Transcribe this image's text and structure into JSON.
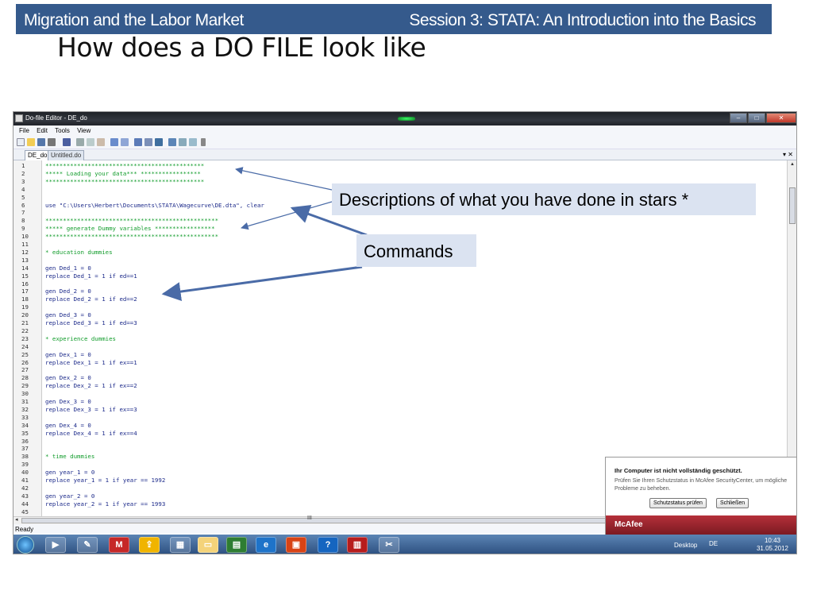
{
  "slide": {
    "course": "Migration and the Labor Market",
    "session": "Session 3: STATA: An Introduction into the Basics",
    "title": "How does a DO FILE look like"
  },
  "window": {
    "title": "Do-file Editor - DE_do",
    "menu": [
      "File",
      "Edit",
      "Tools",
      "View"
    ],
    "tabs": [
      {
        "label": "DE_do",
        "active": true
      },
      {
        "label": "Untitled.do",
        "active": false
      }
    ],
    "status": "Ready",
    "scroll_marker": "III"
  },
  "code_lines": [
    {
      "n": "1",
      "text": "*********************************************",
      "color": "green"
    },
    {
      "n": "2",
      "text": "***** Loading your data*** *****************",
      "color": "green"
    },
    {
      "n": "3",
      "text": "*********************************************",
      "color": "green"
    },
    {
      "n": "4",
      "text": "",
      "color": "navy"
    },
    {
      "n": "5",
      "text": "",
      "color": "navy"
    },
    {
      "n": "6",
      "text": "use \"C:\\Users\\Herbert\\Documents\\STATA\\Wagecurve\\DE.dta\", clear",
      "color": "navy"
    },
    {
      "n": "7",
      "text": "",
      "color": "navy"
    },
    {
      "n": "8",
      "text": "*************************************************",
      "color": "green"
    },
    {
      "n": "9",
      "text": "***** generate Dummy variables *****************",
      "color": "green"
    },
    {
      "n": "10",
      "text": "*************************************************",
      "color": "green"
    },
    {
      "n": "11",
      "text": "",
      "color": "navy"
    },
    {
      "n": "12",
      "text": "* education dummies",
      "color": "green"
    },
    {
      "n": "13",
      "text": "",
      "color": "navy"
    },
    {
      "n": "14",
      "text": "gen Ded_1 = 0",
      "color": "navy"
    },
    {
      "n": "15",
      "text": "replace Ded_1 = 1 if ed==1",
      "color": "navy"
    },
    {
      "n": "16",
      "text": "",
      "color": "navy"
    },
    {
      "n": "17",
      "text": "gen Ded_2 = 0",
      "color": "navy"
    },
    {
      "n": "18",
      "text": "replace Ded_2 = 1 if ed==2",
      "color": "navy"
    },
    {
      "n": "19",
      "text": "",
      "color": "navy"
    },
    {
      "n": "20",
      "text": "gen Ded_3 = 0",
      "color": "navy"
    },
    {
      "n": "21",
      "text": "replace Ded_3 = 1 if ed==3",
      "color": "navy"
    },
    {
      "n": "22",
      "text": "",
      "color": "navy"
    },
    {
      "n": "23",
      "text": "* experience dummies",
      "color": "green"
    },
    {
      "n": "24",
      "text": "",
      "color": "navy"
    },
    {
      "n": "25",
      "text": "gen Dex_1 = 0",
      "color": "navy"
    },
    {
      "n": "26",
      "text": "replace Dex_1 = 1 if ex==1",
      "color": "navy"
    },
    {
      "n": "27",
      "text": "",
      "color": "navy"
    },
    {
      "n": "28",
      "text": "gen Dex_2 = 0",
      "color": "navy"
    },
    {
      "n": "29",
      "text": "replace Dex_2 = 1 if ex==2",
      "color": "navy"
    },
    {
      "n": "30",
      "text": "",
      "color": "navy"
    },
    {
      "n": "31",
      "text": "gen Dex_3 = 0",
      "color": "navy"
    },
    {
      "n": "32",
      "text": "replace Dex_3 = 1 if ex==3",
      "color": "navy"
    },
    {
      "n": "33",
      "text": "",
      "color": "navy"
    },
    {
      "n": "34",
      "text": "gen Dex_4 = 0",
      "color": "navy"
    },
    {
      "n": "35",
      "text": "replace Dex_4 = 1 if ex==4",
      "color": "navy"
    },
    {
      "n": "36",
      "text": "",
      "color": "navy"
    },
    {
      "n": "37",
      "text": "",
      "color": "navy"
    },
    {
      "n": "38",
      "text": "* time dummies",
      "color": "green"
    },
    {
      "n": "39",
      "text": "",
      "color": "navy"
    },
    {
      "n": "40",
      "text": "gen year_1 = 0",
      "color": "navy"
    },
    {
      "n": "41",
      "text": "replace year_1 = 1 if year == 1992",
      "color": "navy"
    },
    {
      "n": "42",
      "text": "",
      "color": "navy"
    },
    {
      "n": "43",
      "text": "gen year_2 = 0",
      "color": "navy"
    },
    {
      "n": "44",
      "text": "replace year_2 = 1 if year == 1993",
      "color": "navy"
    },
    {
      "n": "45",
      "text": "",
      "color": "navy"
    }
  ],
  "callouts": {
    "descriptions": "Descriptions of what you have done in stars *",
    "commands": "Commands"
  },
  "popup": {
    "title": "Ihr Computer ist nicht vollständig geschützt.",
    "body": "Prüfen Sie Ihren Schutzstatus in McAfee SecurityCenter, um mögliche Probleme zu beheben.",
    "check_button": "Schutzstatus prüfen",
    "close_button": "Schließen",
    "brand": "McAfee"
  },
  "taskbar": {
    "desktop_label": "Desktop",
    "language": "DE",
    "time": "10:43",
    "date": "31.05.2012",
    "m_icon_label": "M"
  },
  "colors": {
    "header_blue": "#355a8c",
    "callout_fill": "#dbe3f1",
    "arrow": "#4a6ba7",
    "comment_green": "#119c2b",
    "code_navy": "#1c2a8a",
    "mcafee_red": "#b5303a"
  }
}
